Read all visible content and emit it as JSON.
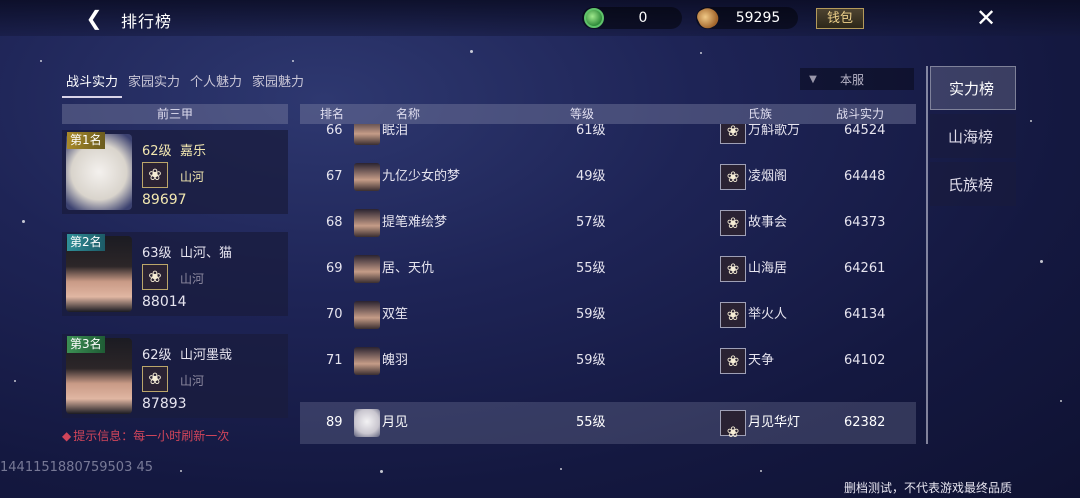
{
  "header": {
    "title": "排行榜",
    "currency_jade": "0",
    "currency_coin": "59295",
    "wallet_label": "钱包"
  },
  "tabs": [
    "战斗实力",
    "家园实力",
    "个人魅力",
    "家园魅力"
  ],
  "server_select": "本服",
  "side_tabs": [
    "实力榜",
    "山海榜",
    "氏族榜"
  ],
  "top3": {
    "header": "前三甲",
    "entries": [
      {
        "badge": "第1名",
        "level": "62级",
        "name": "嘉乐",
        "clan": "山河",
        "power": "89697"
      },
      {
        "badge": "第2名",
        "level": "63级",
        "name": "山河、猫",
        "clan": "山河",
        "power": "88014"
      },
      {
        "badge": "第3名",
        "level": "62级",
        "name": "山河墨哉",
        "clan": "山河",
        "power": "87893"
      }
    ],
    "tip": "提示信息：每一小时刷新一次"
  },
  "table": {
    "headers": {
      "rank": "排名",
      "name": "名称",
      "level": "等级",
      "clan": "氏族",
      "power": "战斗实力"
    },
    "partial_row": {
      "rank": "66",
      "name": "眠泪",
      "level": "61级",
      "clan": "万斛歌万",
      "power": "64524"
    },
    "rows": [
      {
        "rank": "67",
        "name": "九亿少女的梦",
        "level": "49级",
        "clan": "凌烟阁",
        "power": "64448"
      },
      {
        "rank": "68",
        "name": "提笔难绘梦",
        "level": "57级",
        "clan": "故事会",
        "power": "64373"
      },
      {
        "rank": "69",
        "name": "居、天仇",
        "level": "55级",
        "clan": "山海居",
        "power": "64261"
      },
      {
        "rank": "70",
        "name": "双笙",
        "level": "59级",
        "clan": "举火人",
        "power": "64134"
      },
      {
        "rank": "71",
        "name": "魄羽",
        "level": "59级",
        "clan": "天争",
        "power": "64102"
      }
    ],
    "self_row": {
      "rank": "89",
      "name": "月见",
      "level": "55级",
      "clan": "月见华灯",
      "power": "62382"
    }
  },
  "footer": {
    "uid": "1441151880759503 45",
    "disclaimer": "删档测试，不代表游戏最终品质"
  }
}
